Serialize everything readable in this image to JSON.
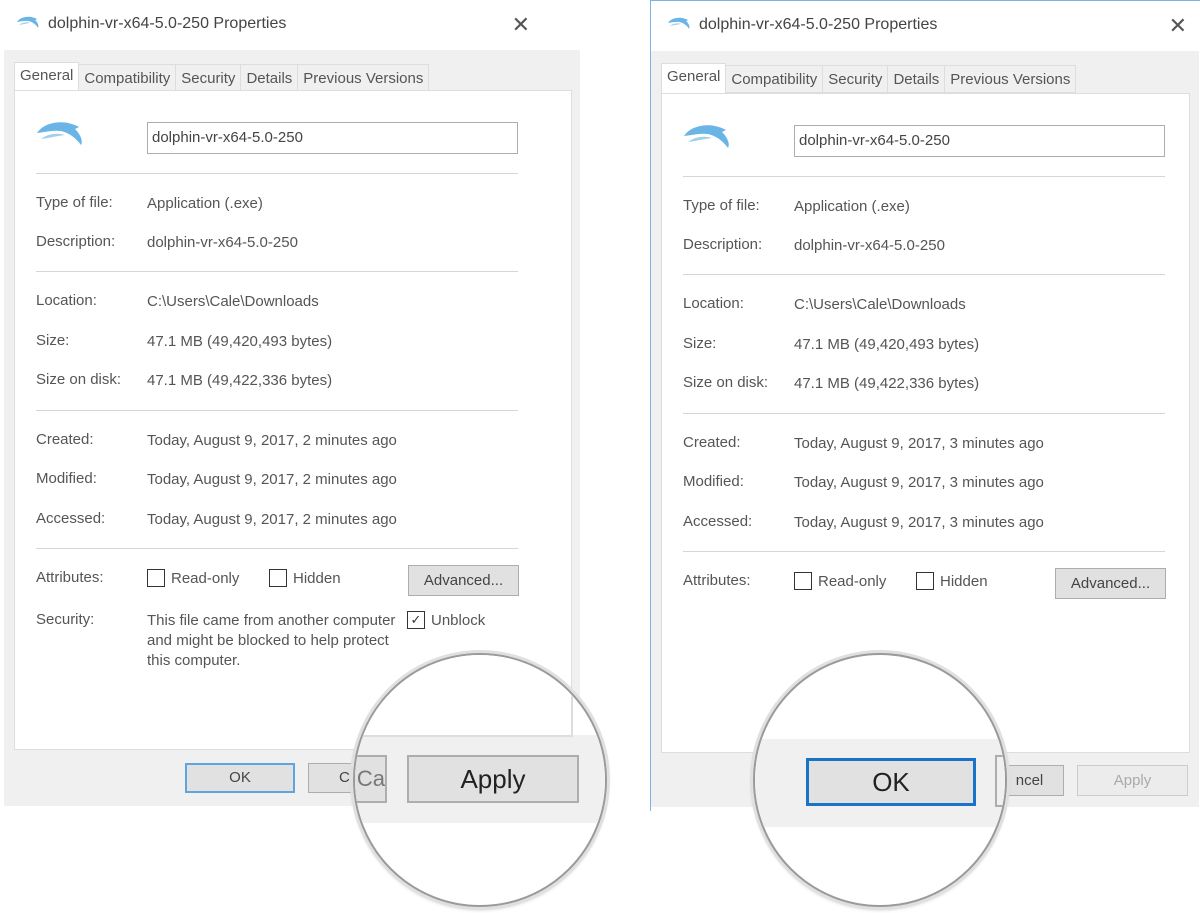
{
  "dialogs": [
    {
      "title": "dolphin-vr-x64-5.0-250 Properties",
      "tabs": [
        "General",
        "Compatibility",
        "Security",
        "Details",
        "Previous Versions"
      ],
      "file_name": "dolphin-vr-x64-5.0-250",
      "type_label": "Type of file:",
      "type_value": "Application (.exe)",
      "desc_label": "Description:",
      "desc_value": "dolphin-vr-x64-5.0-250",
      "loc_label": "Location:",
      "loc_value": "C:\\Users\\Cale\\Downloads",
      "size_label": "Size:",
      "size_value": "47.1 MB (49,420,493 bytes)",
      "disk_label": "Size on disk:",
      "disk_value": "47.1 MB (49,422,336 bytes)",
      "created_label": "Created:",
      "created_value": "Today, August 9, 2017, 2 minutes ago",
      "modified_label": "Modified:",
      "modified_value": "Today, August 9, 2017, 2 minutes ago",
      "accessed_label": "Accessed:",
      "accessed_value": "Today, August 9, 2017, 2 minutes ago",
      "attr_label": "Attributes:",
      "readonly_label": "Read-only",
      "hidden_label": "Hidden",
      "advanced_label": "Advanced...",
      "security_label": "Security:",
      "security_text": "This file came from another computer and might be blocked to help protect this computer.",
      "unblock_label": "Unblock",
      "unblock_checked": true,
      "ok_label": "OK",
      "cancel_label": "Cancel",
      "apply_label": "Apply",
      "magnified": "Apply",
      "magnified_cancel_fragment": "Ca"
    },
    {
      "title": "dolphin-vr-x64-5.0-250 Properties",
      "tabs": [
        "General",
        "Compatibility",
        "Security",
        "Details",
        "Previous Versions"
      ],
      "file_name": "dolphin-vr-x64-5.0-250",
      "type_label": "Type of file:",
      "type_value": "Application (.exe)",
      "desc_label": "Description:",
      "desc_value": "dolphin-vr-x64-5.0-250",
      "loc_label": "Location:",
      "loc_value": "C:\\Users\\Cale\\Downloads",
      "size_label": "Size:",
      "size_value": "47.1 MB (49,420,493 bytes)",
      "disk_label": "Size on disk:",
      "disk_value": "47.1 MB (49,422,336 bytes)",
      "created_label": "Created:",
      "created_value": "Today, August 9, 2017, 3 minutes ago",
      "modified_label": "Modified:",
      "modified_value": "Today, August 9, 2017, 3 minutes ago",
      "accessed_label": "Accessed:",
      "accessed_value": "Today, August 9, 2017, 3 minutes ago",
      "attr_label": "Attributes:",
      "readonly_label": "Read-only",
      "hidden_label": "Hidden",
      "advanced_label": "Advanced...",
      "ok_label": "OK",
      "cancel_label": "ncel",
      "apply_label": "Apply",
      "magnified": "OK"
    }
  ],
  "colors": {
    "accent": "#1a73c9",
    "dolphin": "#6ab4e6",
    "dialog_bg": "#f0f0f0"
  }
}
